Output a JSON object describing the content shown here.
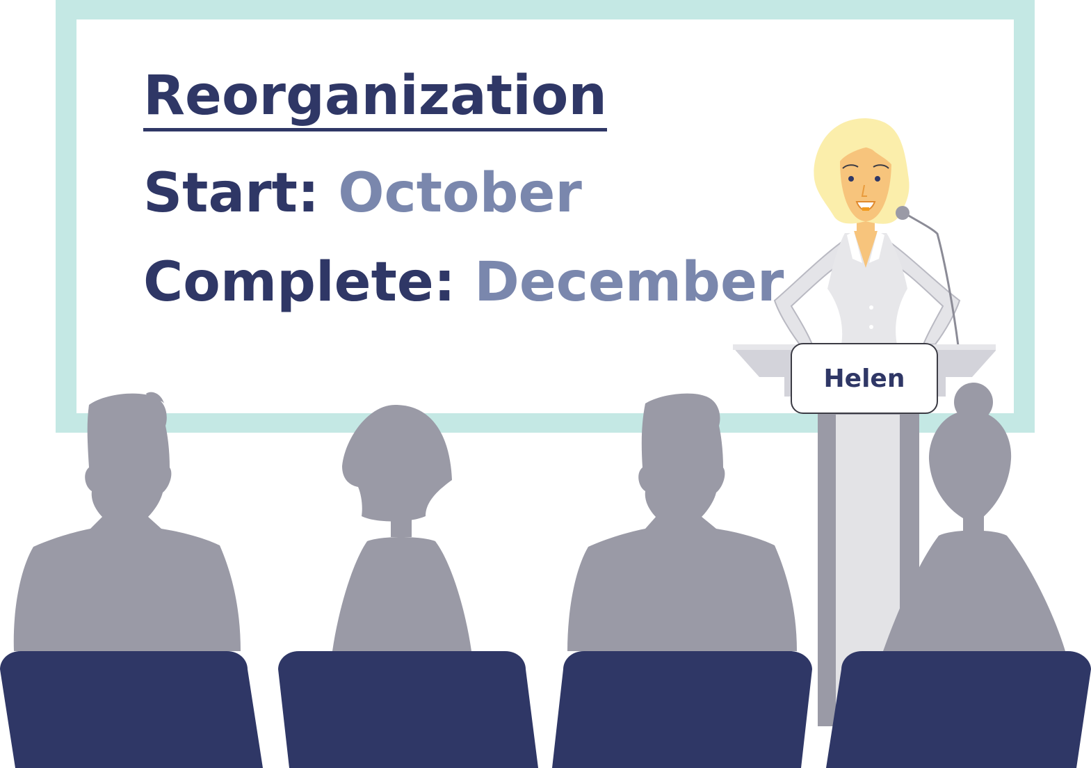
{
  "screen": {
    "title": "Reorganization",
    "start_label": "Start:",
    "start_value": "October",
    "complete_label": "Complete:",
    "complete_value": "December"
  },
  "nameplate": {
    "name": "Helen"
  },
  "colors": {
    "screen_frame": "#c4e8e4",
    "text_dark": "#2f3766",
    "text_accent": "#7a87ad",
    "silhouette": "#9a9aa6",
    "chair": "#2f3766",
    "podium": "#d3d3da",
    "hair": "#fbeeab",
    "skin": "#f7c47c"
  }
}
